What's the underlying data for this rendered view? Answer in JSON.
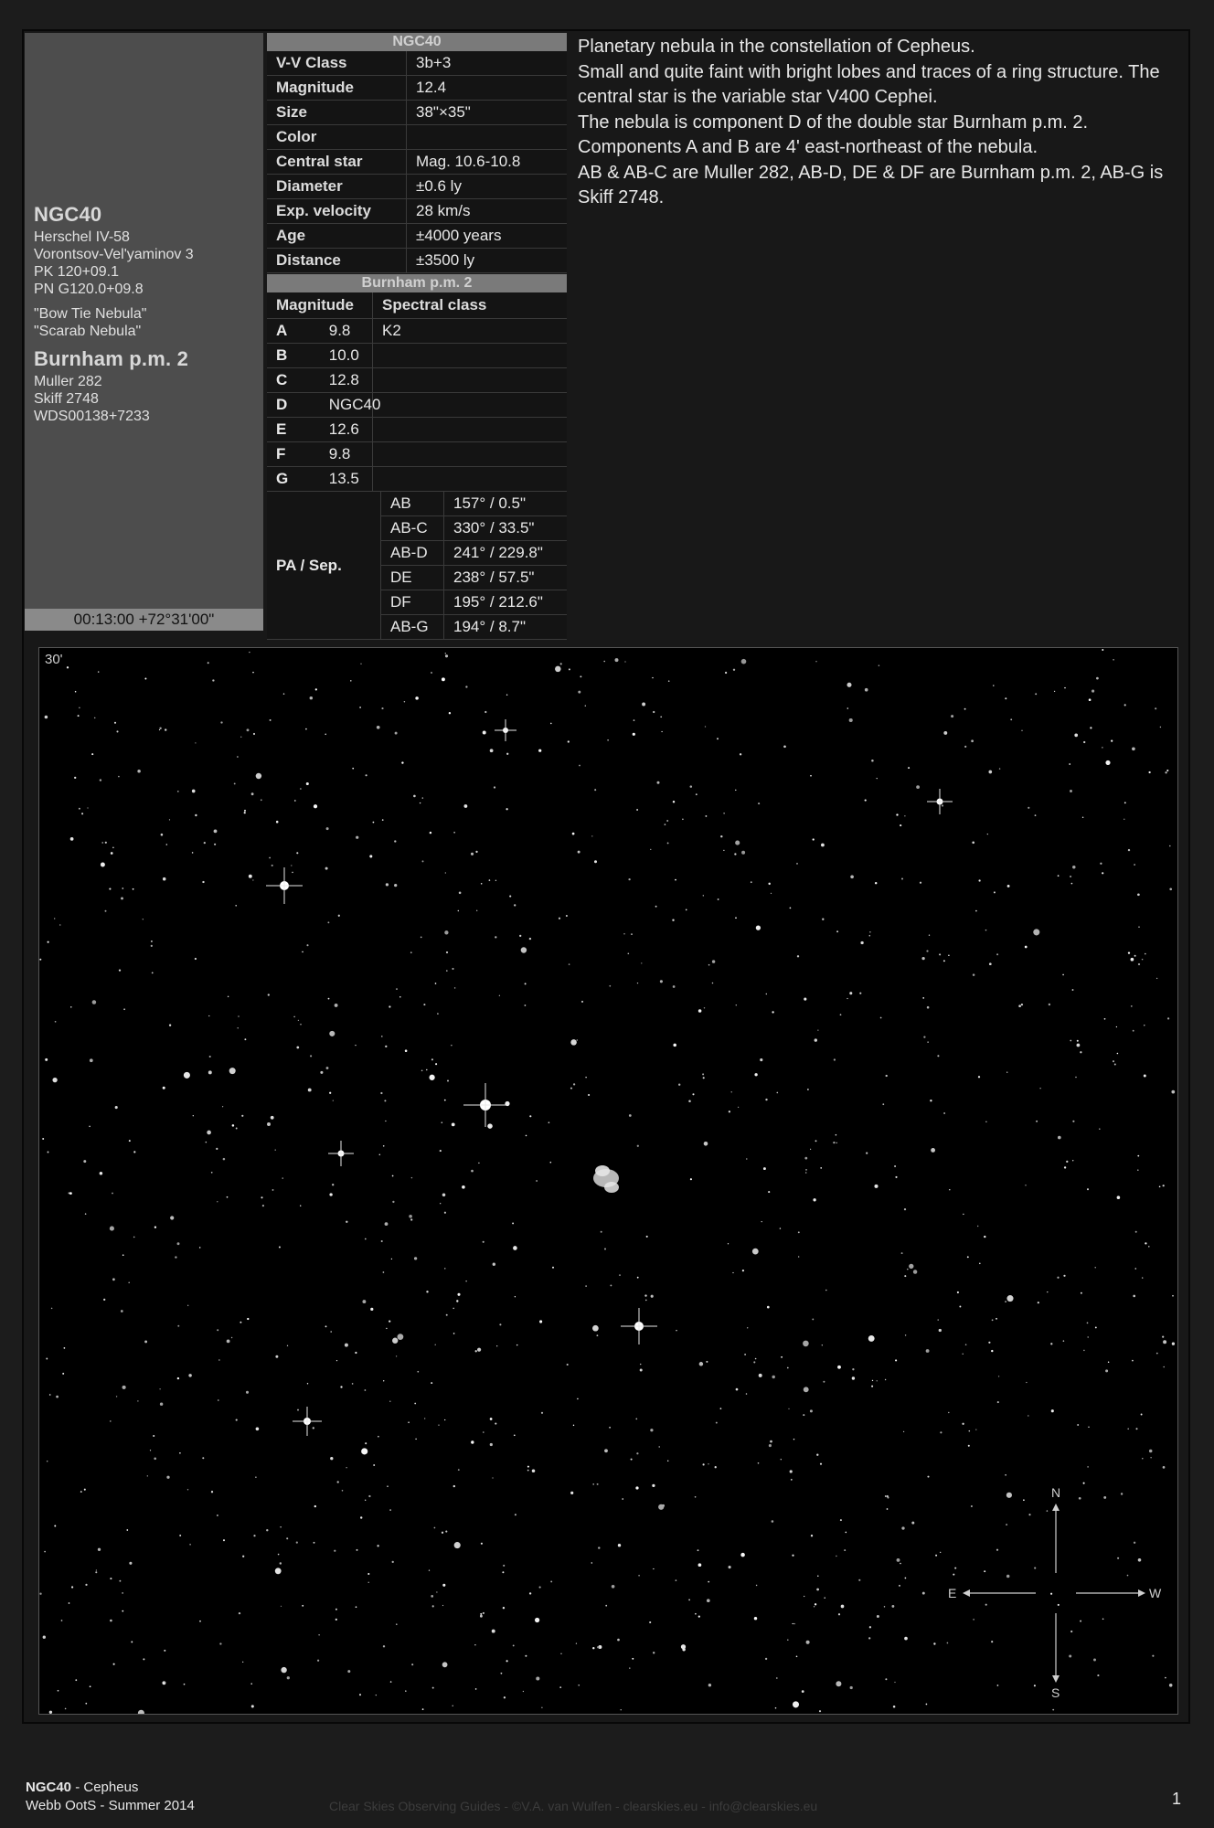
{
  "left": {
    "title": "NGC40",
    "designations": [
      "Herschel IV-58",
      "Vorontsov-Vel'yaminov 3",
      "PK 120+09.1",
      "PN G120.0+09.8"
    ],
    "nicknames": [
      "\"Bow Tie Nebula\"",
      "\"Scarab Nebula\""
    ],
    "double_title": "Burnham p.m. 2",
    "double_designations": [
      "Muller 282",
      "Skiff 2748",
      "WDS00138+7233"
    ],
    "coordinates": "00:13:00 +72°31'00\""
  },
  "table": {
    "header": "NGC40",
    "rows": [
      {
        "key": "V-V Class",
        "value": "3b+3"
      },
      {
        "key": "Magnitude",
        "value": "12.4"
      },
      {
        "key": "Size",
        "value": "38\"×35\""
      },
      {
        "key": "Color",
        "value": ""
      },
      {
        "key": "Central star",
        "value": "Mag. 10.6-10.8"
      },
      {
        "key": "Diameter",
        "value": "±0.6 ly"
      },
      {
        "key": "Exp. velocity",
        "value": "28 km/s"
      },
      {
        "key": "Age",
        "value": "±4000 years"
      },
      {
        "key": "Distance",
        "value": "±3500 ly"
      }
    ]
  },
  "burnham": {
    "header": "Burnham p.m. 2",
    "col_magnitude": "Magnitude",
    "col_spectral": "Spectral class",
    "components": [
      {
        "c": "A",
        "mag": "9.8",
        "spec": "K2"
      },
      {
        "c": "B",
        "mag": "10.0",
        "spec": ""
      },
      {
        "c": "C",
        "mag": "12.8",
        "spec": ""
      },
      {
        "c": "D",
        "mag": "NGC40",
        "spec": ""
      },
      {
        "c": "E",
        "mag": "12.6",
        "spec": ""
      },
      {
        "c": "F",
        "mag": "9.8",
        "spec": ""
      },
      {
        "c": "G",
        "mag": "13.5",
        "spec": ""
      }
    ],
    "pa_label": "PA / Sep.",
    "pa": [
      {
        "pair": "AB",
        "val": "157° / 0.5\""
      },
      {
        "pair": "AB-C",
        "val": "330° / 33.5\""
      },
      {
        "pair": "AB-D",
        "val": "241° / 229.8\""
      },
      {
        "pair": "DE",
        "val": "238° / 57.5\""
      },
      {
        "pair": "DF",
        "val": "195° / 212.6\""
      },
      {
        "pair": "AB-G",
        "val": "194° / 8.7\""
      }
    ]
  },
  "description": [
    "Planetary nebula in the constellation of Cepheus.",
    "Small and quite faint with bright lobes and traces of a ring structure. The central star is the variable star V400 Cephei.",
    "The nebula is component D of the double star Burnham p.m. 2. Components A and B are 4' east-northeast of the nebula.",
    "AB & AB-C are Muller 282, AB-D, DE & DF are Burnham p.m. 2, AB-G is Skiff 2748."
  ],
  "image": {
    "scale_label": "30'",
    "compass": {
      "n": "N",
      "s": "S",
      "e": "E",
      "w": "W"
    }
  },
  "footer": {
    "object": "NGC40",
    "constellation": " - Cepheus",
    "edition": "Webb OotS - Summer 2014",
    "credits": "Clear Skies Observing Guides - ©V.A. van Wulfen - clearskies.eu - info@clearskies.eu",
    "page": "1"
  },
  "colors": {
    "background": "#1c1c1c",
    "panel": "#4d4d4d",
    "header_bar": "#7a7a7a"
  }
}
